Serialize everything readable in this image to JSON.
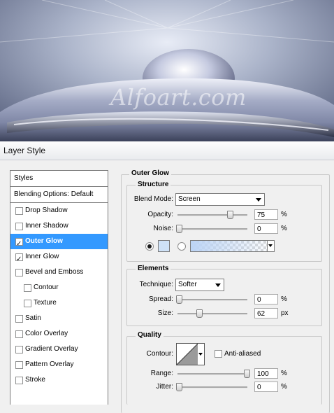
{
  "preview": {
    "watermark": "Alfoart.com"
  },
  "dialog": {
    "title": "Layer Style"
  },
  "left_panel": {
    "header": "Styles",
    "blending": "Blending Options: Default",
    "items": [
      {
        "label": "Drop Shadow",
        "checked": false
      },
      {
        "label": "Inner Shadow",
        "checked": false
      },
      {
        "label": "Outer Glow",
        "checked": true
      },
      {
        "label": "Inner Glow",
        "checked": true
      },
      {
        "label": "Bevel and Emboss",
        "checked": false
      },
      {
        "label": "Contour",
        "checked": false
      },
      {
        "label": "Texture",
        "checked": false
      },
      {
        "label": "Satin",
        "checked": false
      },
      {
        "label": "Color Overlay",
        "checked": false
      },
      {
        "label": "Gradient Overlay",
        "checked": false
      },
      {
        "label": "Pattern Overlay",
        "checked": false
      },
      {
        "label": "Stroke",
        "checked": false
      }
    ],
    "selected": "Outer Glow"
  },
  "outer_glow": {
    "title": "Outer Glow",
    "structure": {
      "title": "Structure",
      "blend_mode_label": "Blend Mode:",
      "blend_mode_value": "Screen",
      "opacity_label": "Opacity:",
      "opacity_value": "75",
      "opacity_unit": "%",
      "noise_label": "Noise:",
      "noise_value": "0",
      "noise_unit": "%",
      "color_mode": "color",
      "swatch_color": "#cfe2f7"
    },
    "elements": {
      "title": "Elements",
      "technique_label": "Technique:",
      "technique_value": "Softer",
      "spread_label": "Spread:",
      "spread_value": "0",
      "spread_unit": "%",
      "size_label": "Size:",
      "size_value": "62",
      "size_unit": "px"
    },
    "quality": {
      "title": "Quality",
      "contour_label": "Contour:",
      "anti_aliased_label": "Anti-aliased",
      "anti_aliased": false,
      "range_label": "Range:",
      "range_value": "100",
      "range_unit": "%",
      "jitter_label": "Jitter:",
      "jitter_value": "0",
      "jitter_unit": "%"
    }
  },
  "colors": {
    "selection": "#3399ff"
  }
}
